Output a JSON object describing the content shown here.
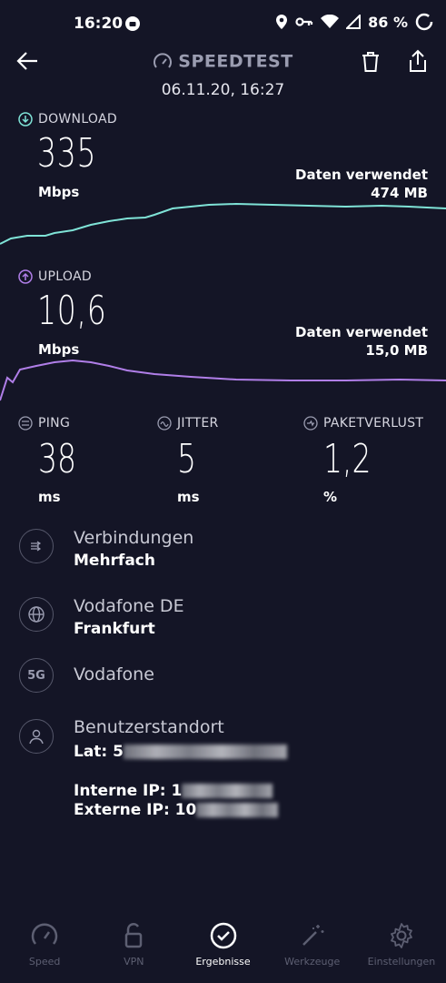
{
  "status": {
    "time": "16:20",
    "battery": "86 %"
  },
  "header": {
    "title": "SPEEDTEST",
    "datetime": "06.11.20, 16:27"
  },
  "download": {
    "label": "DOWNLOAD",
    "value": "335",
    "unit": "Mbps",
    "data_label": "Daten verwendet",
    "data_value": "474 MB",
    "color": "#7fe3d7"
  },
  "upload": {
    "label": "UPLOAD",
    "value": "10,6",
    "unit": "Mbps",
    "data_label": "Daten verwendet",
    "data_value": "15,0 MB",
    "color": "#b07ee8"
  },
  "metrics": {
    "ping": {
      "label": "PING",
      "value": "38",
      "unit": "ms"
    },
    "jitter": {
      "label": "JITTER",
      "value": "5",
      "unit": "ms"
    },
    "loss": {
      "label": "PAKETVERLUST",
      "value": "1,2",
      "unit": "%"
    }
  },
  "info": {
    "connections": {
      "title": "Verbindungen",
      "value": "Mehrfach"
    },
    "provider": {
      "title": "Vodafone DE",
      "value": "Frankfurt"
    },
    "network": {
      "icon_text": "5G",
      "title": "Vodafone"
    },
    "location": {
      "title": "Benutzerstandort",
      "lat_label": "Lat: 5",
      "internal_ip_label": "Interne IP: 1",
      "external_ip_label": "Externe IP: 10"
    }
  },
  "nav": {
    "items": [
      {
        "label": "Speed",
        "icon": "gauge-icon"
      },
      {
        "label": "VPN",
        "icon": "lock-icon"
      },
      {
        "label": "Ergebnisse",
        "icon": "check-circle-icon"
      },
      {
        "label": "Werkzeuge",
        "icon": "wand-icon"
      },
      {
        "label": "Einstellungen",
        "icon": "gear-icon"
      }
    ],
    "active": "Ergebnisse"
  }
}
